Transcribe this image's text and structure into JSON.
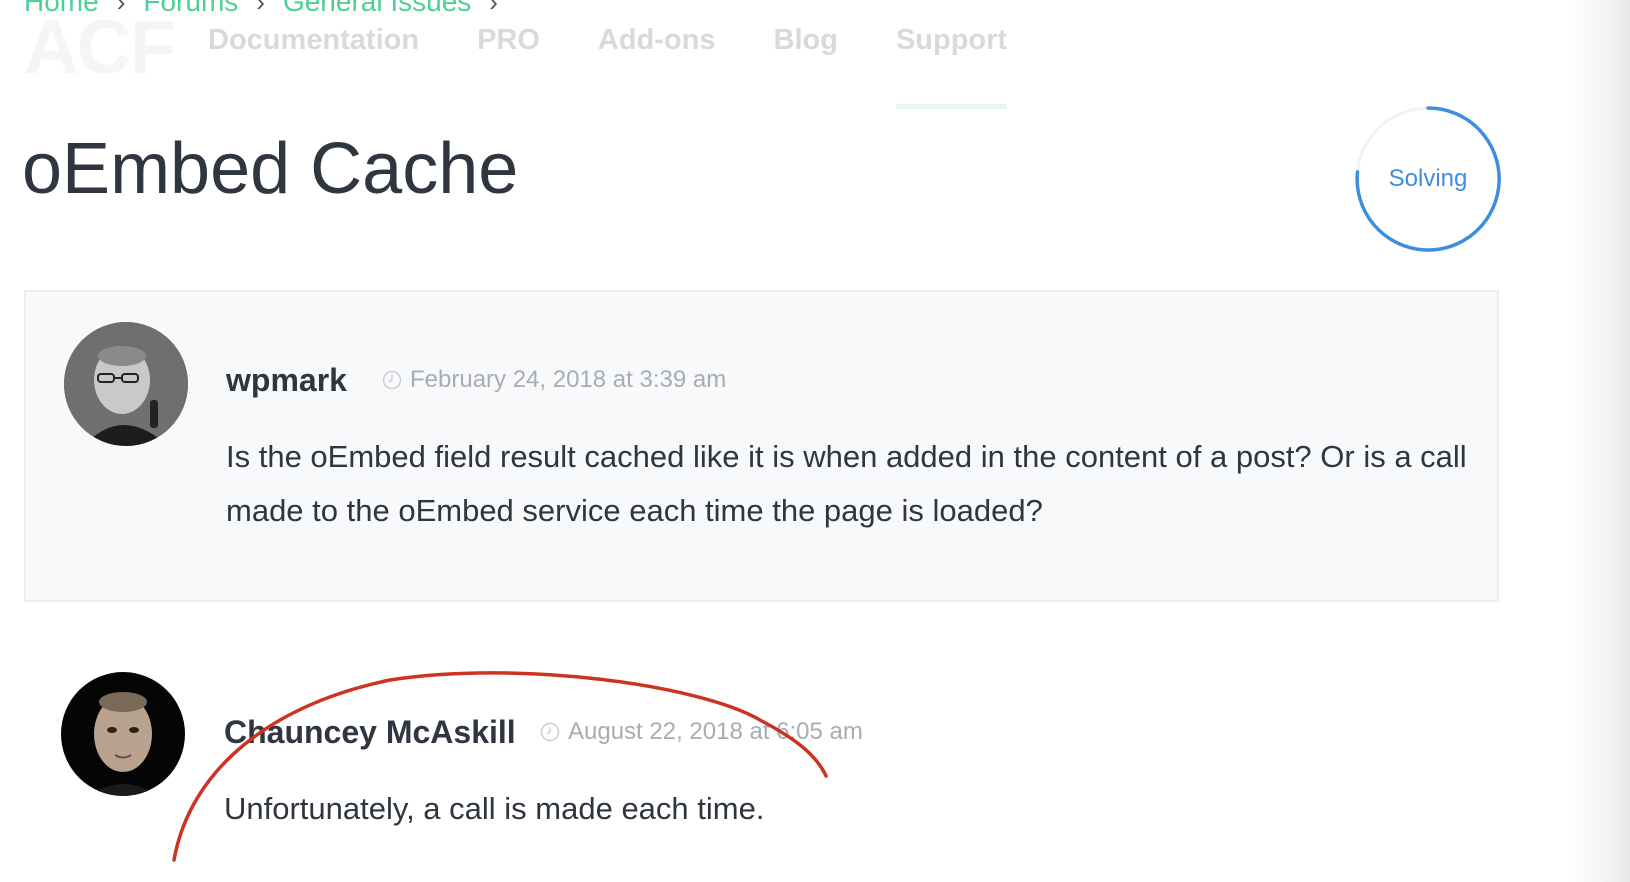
{
  "breadcrumb": {
    "items": [
      "Home",
      "Forums",
      "General Issues"
    ],
    "separator": "›"
  },
  "header": {
    "logo": "ACF",
    "nav": [
      "Documentation",
      "PRO",
      "Add-ons",
      "Blog",
      "Support"
    ],
    "active_nav": "Support"
  },
  "topic": {
    "title": "oEmbed Cache",
    "status": "Solving",
    "status_color": "#3c8ee0"
  },
  "posts": [
    {
      "author": "wpmark",
      "date": "February 24, 2018 at 3:39 am",
      "avatar": "avatar-photo",
      "body": "Is the oEmbed field result cached like it is when added in the content of a post? Or is a call made to the oEmbed service each time the page is loaded?"
    },
    {
      "author": "Chauncey McAskill",
      "date": "August 22, 2018 at 6:05 am",
      "avatar": "avatar-photo",
      "body": "Unfortunately, a call is made each time."
    }
  ],
  "colors": {
    "accent_green": "#4fcf98",
    "annotation_red": "#cc3321",
    "text_dark": "#2f3640",
    "meta_gray": "#a8adb3"
  },
  "icons": {
    "date": "clock-icon"
  }
}
